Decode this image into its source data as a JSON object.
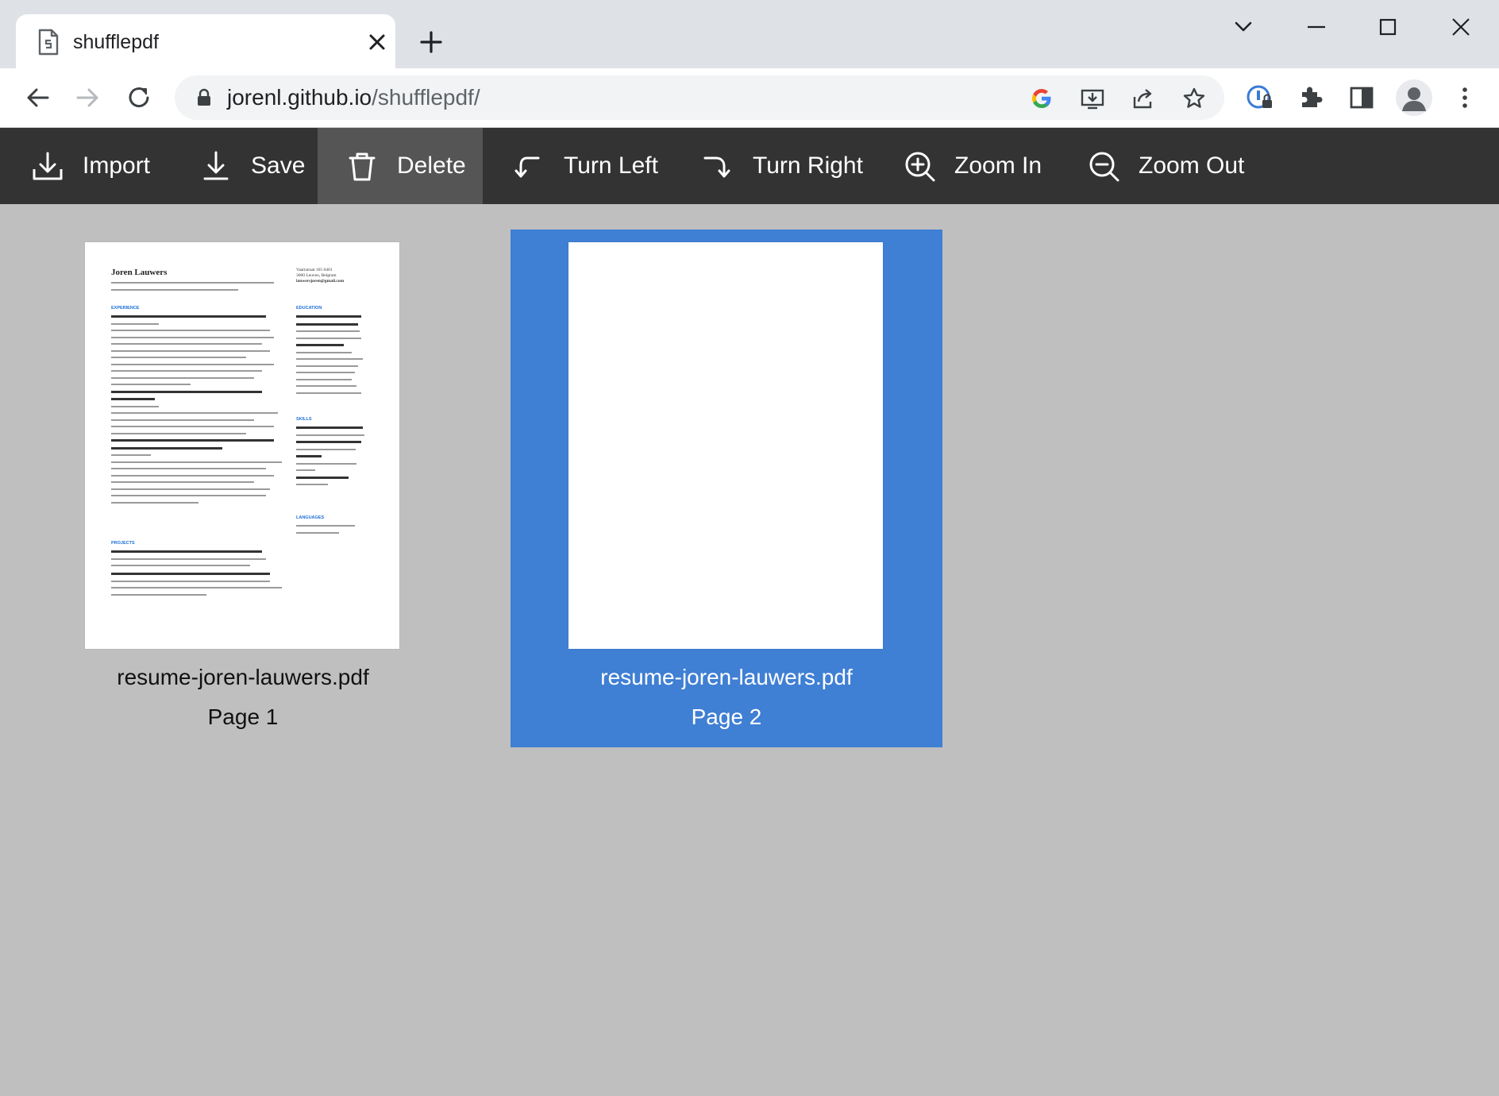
{
  "browser": {
    "tab_title": "shufflepdf",
    "url_host": "jorenl.github.io",
    "url_path": "/shufflepdf/"
  },
  "toolbar": {
    "import_label": "Import",
    "save_label": "Save",
    "delete_label": "Delete",
    "turn_left_label": "Turn Left",
    "turn_right_label": "Turn Right",
    "zoom_in_label": "Zoom In",
    "zoom_out_label": "Zoom Out",
    "active_item": "Delete"
  },
  "pages": [
    {
      "file": "resume-joren-lauwers.pdf",
      "label": "Page 1",
      "selected": false
    },
    {
      "file": "resume-joren-lauwers.pdf",
      "label": "Page 2",
      "selected": true
    }
  ],
  "resume_preview": {
    "name": "Joren Lauwers",
    "contact": [
      "Vaartstraat 165 0401",
      "3000 Leuven, Belgium",
      "lauwersjoren@gmail.com"
    ],
    "sections": {
      "experience": "EXPERIENCE",
      "education": "EDUCATION",
      "skills": "SKILLS",
      "languages": "LANGUAGES",
      "projects": "PROJECTS"
    }
  },
  "colors": {
    "selected_accent": "#3f7fd4",
    "toolbar_bg": "#333333",
    "workspace_bg": "#bfbfbf"
  }
}
